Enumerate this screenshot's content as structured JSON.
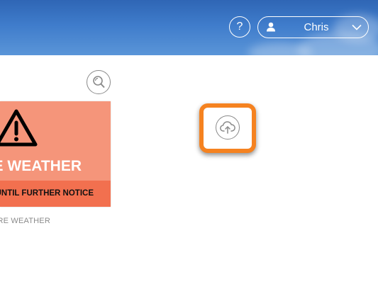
{
  "header": {
    "help_label": "?",
    "user": {
      "name": "Chris",
      "icon": "user-icon",
      "dropdown_icon": "chevron-down-icon"
    }
  },
  "toolbar": {
    "search_icon": "search-icon",
    "upload_icon": "cloud-upload-icon",
    "highlight_color": "#f58220"
  },
  "tile": {
    "icon": "warning-icon",
    "title": "E WEATHER",
    "subtitle": "UNTIL FURTHER NOTICE",
    "caption": "RE WEATHER",
    "colors": {
      "background": "#f5957a",
      "band": "#f2704f"
    }
  }
}
